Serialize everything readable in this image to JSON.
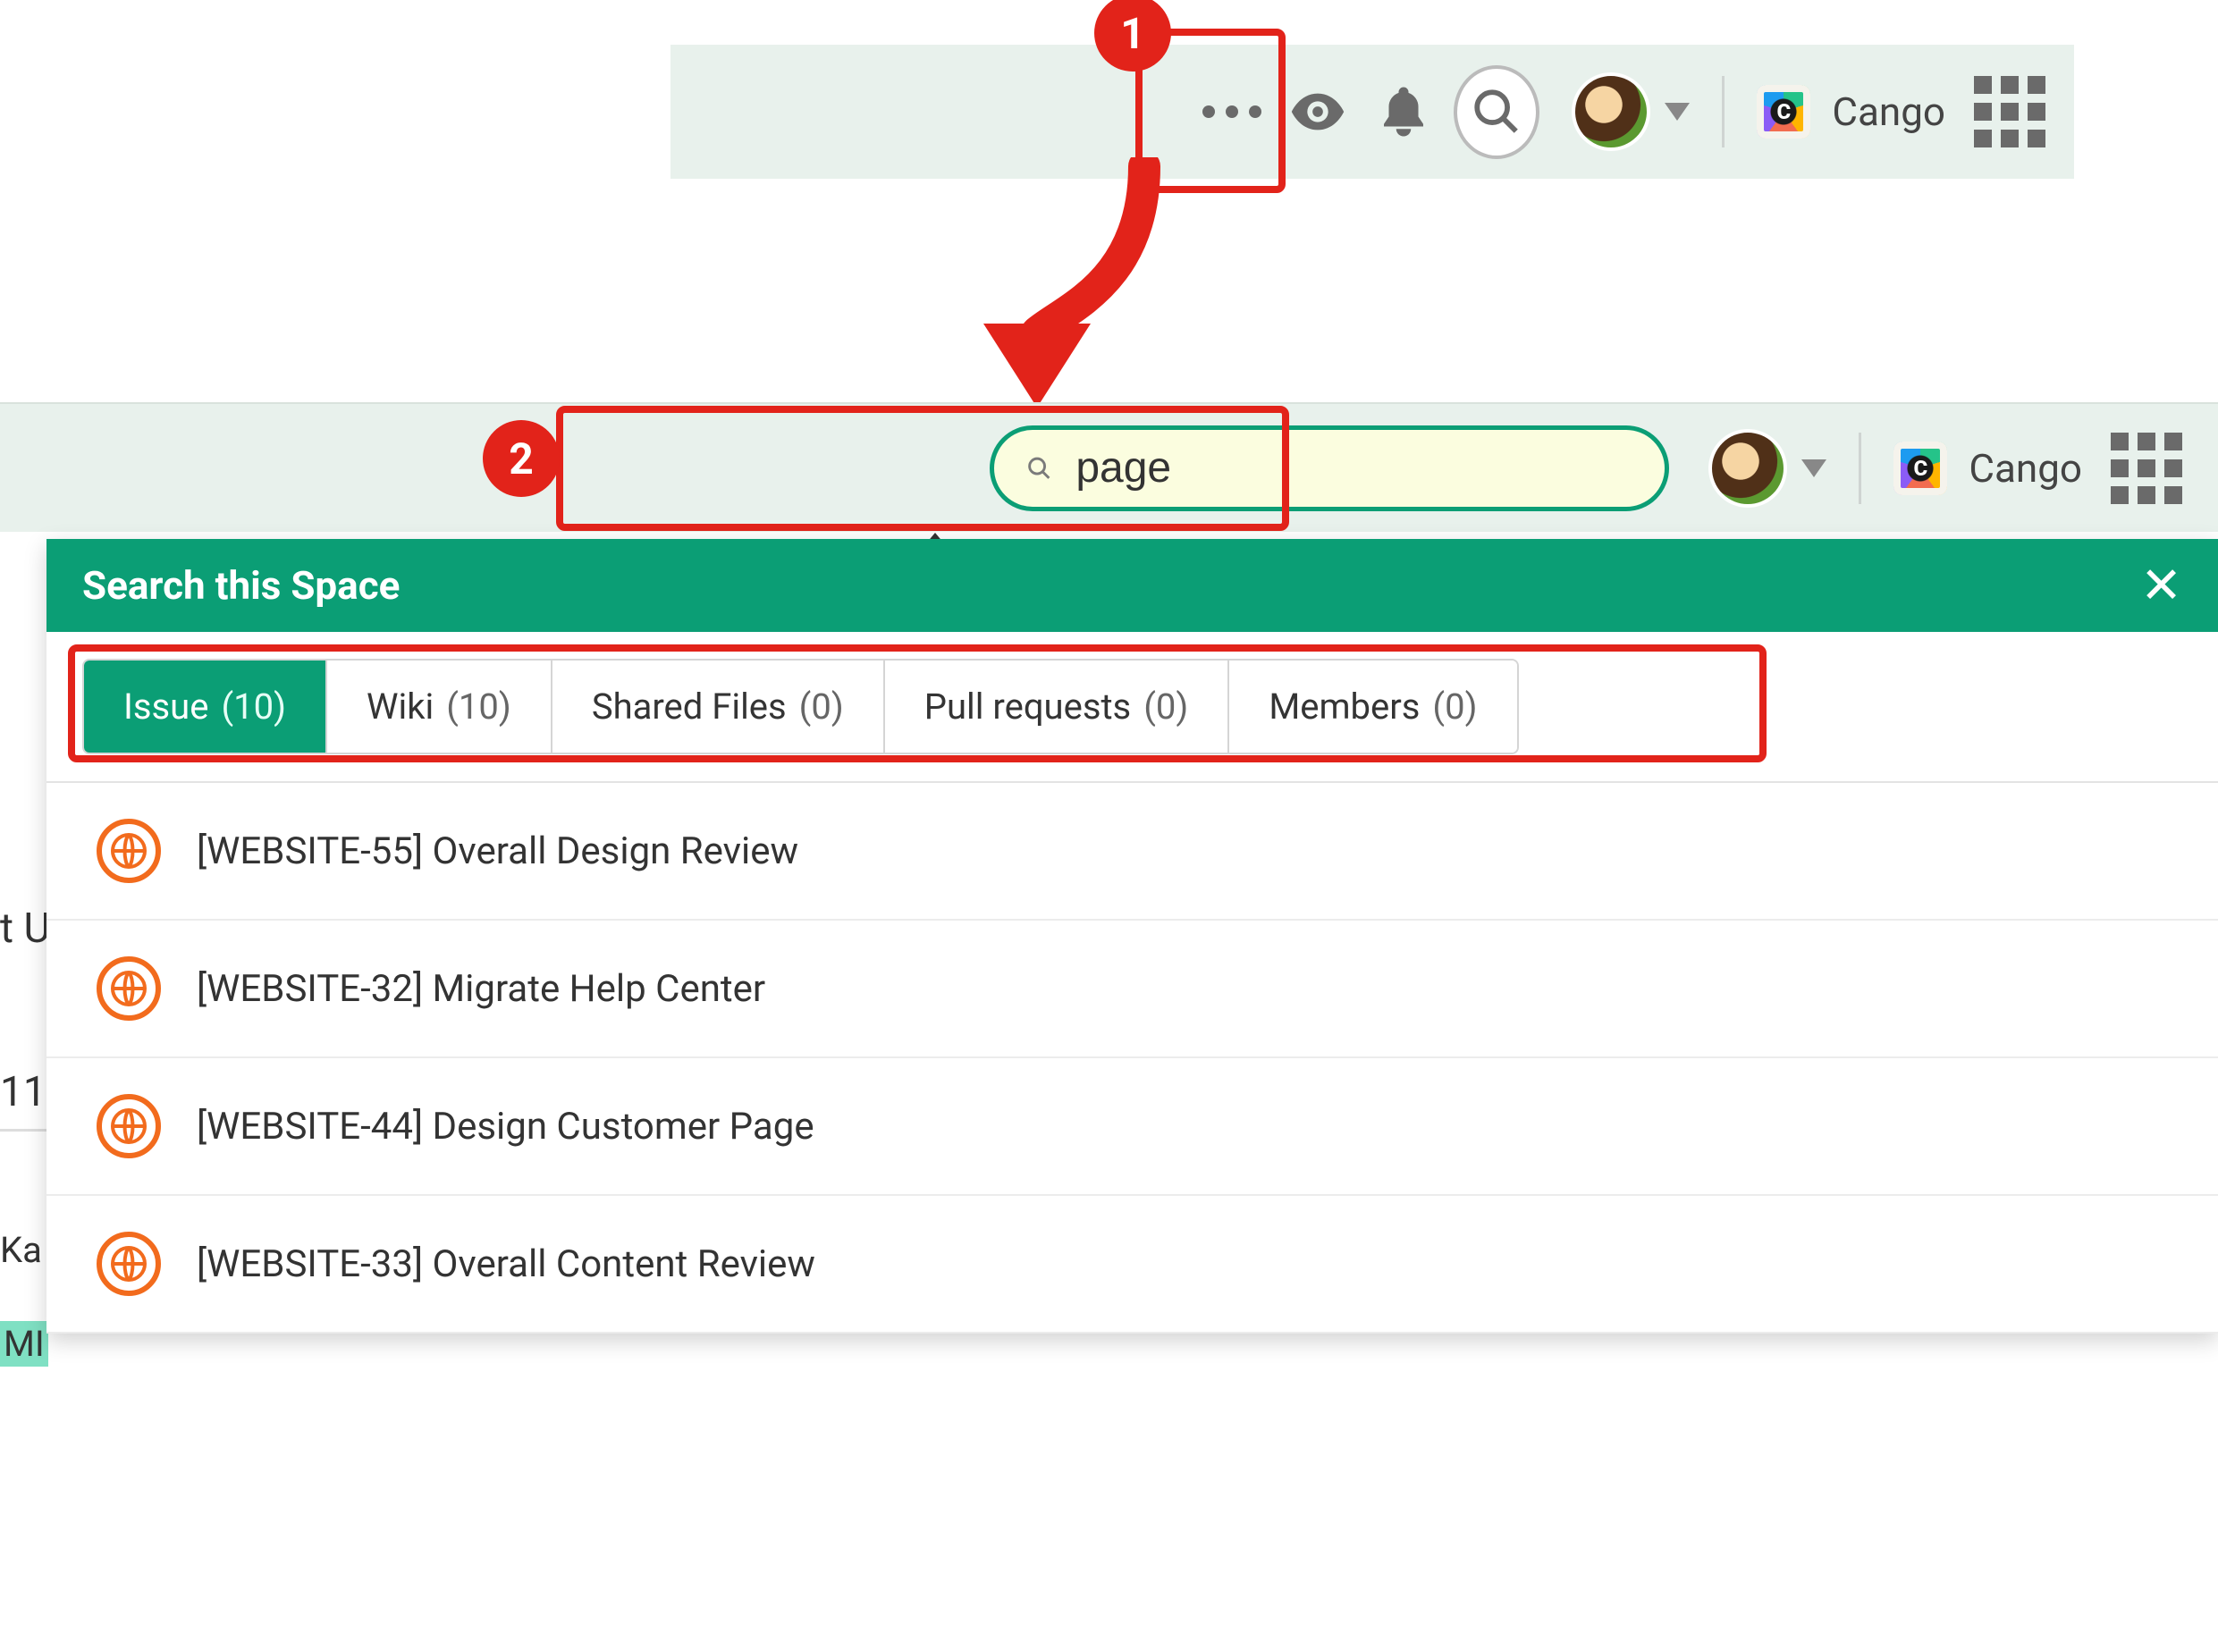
{
  "callouts": {
    "step1": "1",
    "step2": "2"
  },
  "toolbar": {
    "org_name": "Cango"
  },
  "search": {
    "value": "page"
  },
  "panel": {
    "title": "Search this Space",
    "tabs": [
      {
        "label": "Issue",
        "count": "(10)",
        "active": true
      },
      {
        "label": "Wiki",
        "count": "(10)",
        "active": false
      },
      {
        "label": "Shared Files",
        "count": "(0)",
        "active": false
      },
      {
        "label": "Pull requests",
        "count": "(0)",
        "active": false
      },
      {
        "label": "Members",
        "count": "(0)",
        "active": false
      }
    ],
    "results": [
      {
        "title": "[WEBSITE-55] Overall Design Review"
      },
      {
        "title": "[WEBSITE-32] Migrate Help Center"
      },
      {
        "title": "[WEBSITE-44] Design Customer Page"
      },
      {
        "title": "[WEBSITE-33] Overall Content Review"
      }
    ]
  },
  "bg": {
    "frag1": "t U",
    "frag2": "11,",
    "frag3": "Ka",
    "frag4": "MI"
  }
}
